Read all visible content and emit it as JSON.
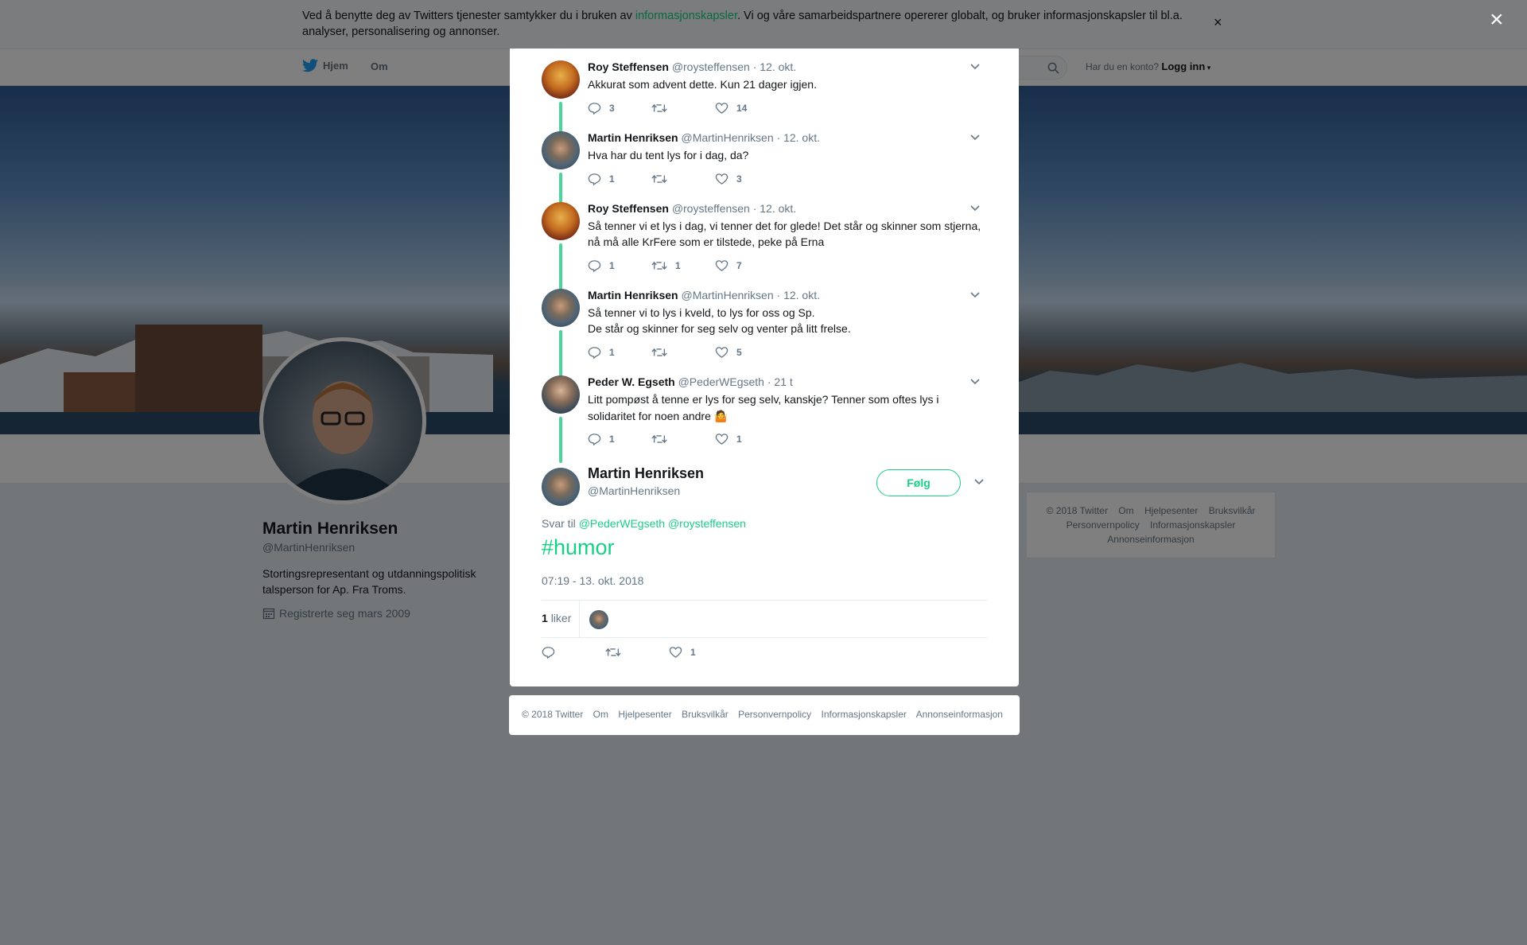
{
  "cookie_notice": {
    "text_before": "Ved å benytte deg av Twitters tjenester samtykker du i bruken av ",
    "link": "informasjonskapsler",
    "text_after": ". Vi og våre samarbeidspartnere opererer globalt, og bruker informasjonskapsler til bl.a. analyser, personalisering og annonser.",
    "close": "×"
  },
  "nav": {
    "home": "Hjem",
    "about": "Om",
    "account_prompt": "Har du en konto?",
    "login": "Logg inn"
  },
  "profile": {
    "name": "Martin Henriksen",
    "handle": "@MartinHenriksen",
    "bio": "Stortingsrepresentant og utdanningspolitisk talsperson for Ap. Fra Troms.",
    "joined": "Registrerte seg mars 2009"
  },
  "side_footer": [
    "© 2018 Twitter",
    "Om",
    "Hjelpesenter",
    "Bruksvilkår",
    "Personvernpolicy",
    "Informasjonskapsler",
    "Annonseinformasjon"
  ],
  "overlay_close": "×",
  "thread": [
    {
      "name": "Roy Steffensen",
      "handle": "@roysteffensen",
      "time": "· 12. okt.",
      "text": "Akkurat som advent dette. Kun 21 dager igjen.",
      "replies": "3",
      "retweets": "",
      "likes": "14",
      "avatar": "roy"
    },
    {
      "name": "Martin Henriksen",
      "handle": "@MartinHenriksen",
      "time": "· 12. okt.",
      "text": "Hva har du tent lys for i dag, da?",
      "replies": "1",
      "retweets": "",
      "likes": "3",
      "avatar": "martin"
    },
    {
      "name": "Roy Steffensen",
      "handle": "@roysteffensen",
      "time": "· 12. okt.",
      "text": "Så tenner vi et lys i dag, vi tenner det for glede! Det står og skinner som stjerna, nå må alle KrFere som er tilstede, peke på Erna",
      "replies": "1",
      "retweets": "1",
      "likes": "7",
      "avatar": "roy"
    },
    {
      "name": "Martin Henriksen",
      "handle": "@MartinHenriksen",
      "time": "· 12. okt.",
      "text_line1": "Så tenner vi to lys i kveld, to lys for oss og Sp.",
      "text_line2": "De står og skinner for seg selv og venter på litt frelse.",
      "replies": "1",
      "retweets": "",
      "likes": "5",
      "avatar": "martin"
    },
    {
      "name": "Peder W. Egseth",
      "handle": "@PederWEgseth",
      "time": "· 21 t",
      "text": "Litt pompøst å tenne er lys for seg selv, kanskje? Tenner som oftes lys i solidaritet for noen andre 🤷",
      "replies": "1",
      "retweets": "",
      "likes": "1",
      "avatar": "peder"
    }
  ],
  "main_tweet": {
    "name": "Martin Henriksen",
    "handle": "@MartinHenriksen",
    "follow": "Følg",
    "reply_prefix": "Svar til",
    "reply_mentions": "@PederWEgseth @roysteffensen",
    "hashtag": "#humor",
    "timestamp": "07:19 - 13. okt. 2018",
    "likes_count": "1",
    "likes_label": "liker",
    "action_likes": "1"
  },
  "modal_footer": [
    "© 2018 Twitter",
    "Om",
    "Hjelpesenter",
    "Bruksvilkår",
    "Personvernpolicy",
    "Informasjonskapsler",
    "Annonseinformasjon"
  ],
  "colors": {
    "accent": "#19cf86",
    "thread_line": "#2cce8a",
    "muted": "#657786"
  }
}
